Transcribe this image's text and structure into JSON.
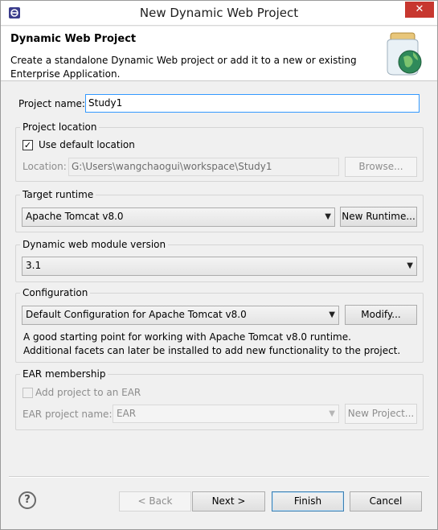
{
  "window": {
    "title": "New Dynamic Web Project",
    "close_glyph": "✕"
  },
  "banner": {
    "title": "Dynamic Web Project",
    "description": "Create a standalone Dynamic Web project or add it to a new or existing Enterprise Application."
  },
  "project_name": {
    "label": "Project name:",
    "value": "Study1"
  },
  "project_location": {
    "group_title": "Project location",
    "use_default_label": "Use default location",
    "use_default_checked": true,
    "location_label": "Location:",
    "location_value": "G:\\Users\\wangchaogui\\workspace\\Study1",
    "browse_label": "Browse..."
  },
  "target_runtime": {
    "group_title": "Target runtime",
    "selected": "Apache Tomcat v8.0",
    "new_runtime_label": "New Runtime..."
  },
  "module_version": {
    "group_title": "Dynamic web module version",
    "selected": "3.1"
  },
  "configuration": {
    "group_title": "Configuration",
    "selected": "Default Configuration for Apache Tomcat v8.0",
    "modify_label": "Modify...",
    "description": "A good starting point for working with Apache Tomcat v8.0 runtime. Additional facets can later be installed to add new functionality to the project."
  },
  "ear": {
    "group_title": "EAR membership",
    "add_label": "Add project to an EAR",
    "add_checked": false,
    "project_name_label": "EAR project name:",
    "project_name_value": "EAR",
    "new_project_label": "New Project..."
  },
  "footer": {
    "help_glyph": "?",
    "back_label": "< Back",
    "next_label": "Next >",
    "finish_label": "Finish",
    "cancel_label": "Cancel"
  },
  "icons": {
    "app": "eclipse-icon",
    "banner": "jar-globe-icon",
    "dropdown": "chevron-down-icon",
    "check": "checkmark-icon"
  },
  "colors": {
    "close": "#c7372f",
    "focus_border": "#3399ff",
    "background": "#f0f0f0"
  }
}
